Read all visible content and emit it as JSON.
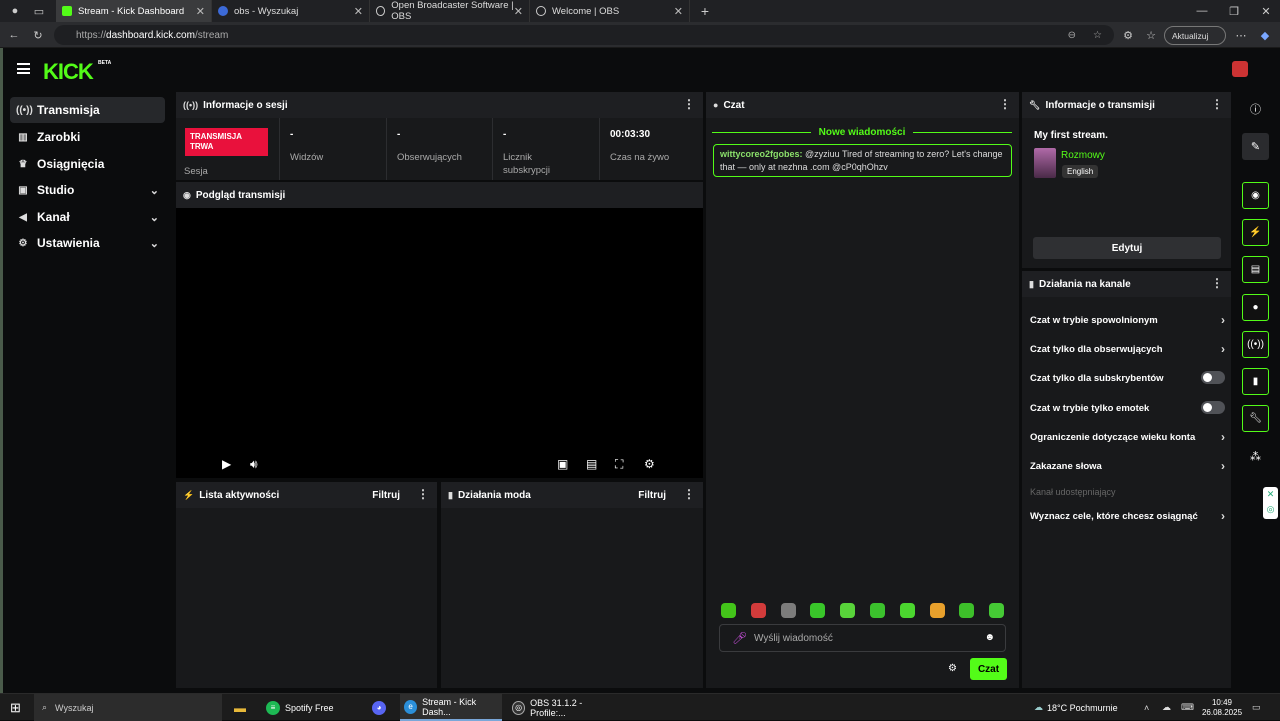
{
  "browser": {
    "tabs": [
      {
        "title": "Stream - Kick Dashboard",
        "active": true
      },
      {
        "title": "obs - Wyszukaj",
        "active": false
      },
      {
        "title": "Open Broadcaster Software | OBS",
        "active": false
      },
      {
        "title": "Welcome | OBS",
        "active": false
      }
    ],
    "url_prefix": "https://",
    "url_host": "dashboard.kick.com",
    "url_path": "/stream",
    "update_label": "Aktualizuj"
  },
  "app": {
    "logo": "KICK",
    "beta": "BETA"
  },
  "sidebar": {
    "items": [
      {
        "label": "Transmisja",
        "icon": "broadcast-icon"
      },
      {
        "label": "Zarobki",
        "icon": "chart-icon"
      },
      {
        "label": "Osiągnięcia",
        "icon": "trophy-icon"
      },
      {
        "label": "Studio",
        "icon": "studio-icon"
      },
      {
        "label": "Kanał",
        "icon": "megaphone-icon"
      },
      {
        "label": "Ustawienia",
        "icon": "gear-icon"
      }
    ]
  },
  "session": {
    "title": "Informacje o sesji",
    "live_badge_line1": "TRANSMISJA",
    "live_badge_line2": "TRWA",
    "session_label": "Sesja",
    "viewers_value": "-",
    "viewers_label": "Widzów",
    "followers_value": "-",
    "followers_label": "Obserwujących",
    "subs_value": "-",
    "subs_label_1": "Licznik",
    "subs_label_2": "subskrypcji",
    "live_time_value": "00:03:30",
    "live_time_label": "Czas na żywo"
  },
  "preview": {
    "title": "Podgląd transmisji"
  },
  "activity": {
    "title": "Lista aktywności",
    "filter": "Filtruj"
  },
  "modactions": {
    "title": "Działania moda",
    "filter": "Filtruj"
  },
  "chat": {
    "title": "Czat",
    "new_messages": "Nowe wiadomości",
    "message_user": "wittycoreo2fgobes:",
    "message_text": "@zyziuu Tired of streaming to zero? Let's change that — only at nezhna .com @cP0qhOhzv",
    "placeholder": "Wyślij wiadomość",
    "send_label": "Czat",
    "emote_colors": [
      "#43c41a",
      "#d23b3b",
      "#7c7c7c",
      "#39c62a",
      "#58d33a",
      "#3bc12d",
      "#4bd62f",
      "#e8a02c",
      "#3dbf2a",
      "#45c935"
    ]
  },
  "stream_info": {
    "title": "Informacje o transmisji",
    "stream_title": "My first stream.",
    "category": "Rozmowy",
    "language": "English",
    "edit_label": "Edytuj"
  },
  "channel_actions": {
    "title": "Działania na kanale",
    "rows": [
      {
        "label": "Czat w trybie spowolnionym",
        "control": "arrow"
      },
      {
        "label": "Czat tylko dla obserwujących",
        "control": "arrow"
      },
      {
        "label": "Czat tylko dla subskrybentów",
        "control": "toggle"
      },
      {
        "label": "Czat w trybie tylko emotek",
        "control": "toggle"
      },
      {
        "label": "Ograniczenie dotyczące wieku konta",
        "control": "arrow"
      },
      {
        "label": "Zakazane słowa",
        "control": "arrow"
      },
      {
        "label": "Kanał udostępniający",
        "control": "none"
      },
      {
        "label": "Wyznacz cele, które chcesz osiągnąć",
        "control": "arrow"
      }
    ]
  },
  "taskbar": {
    "search": "Wyszukaj",
    "items": [
      "Spotify Free",
      "Stream - Kick Dash...",
      "OBS 31.1.2 - Profile:..."
    ],
    "weather": "18°C  Pochmurnie",
    "time": "10:49",
    "date": "26.08.2025"
  },
  "colors": {
    "accent": "#53fc18",
    "live": "#e9113c"
  }
}
